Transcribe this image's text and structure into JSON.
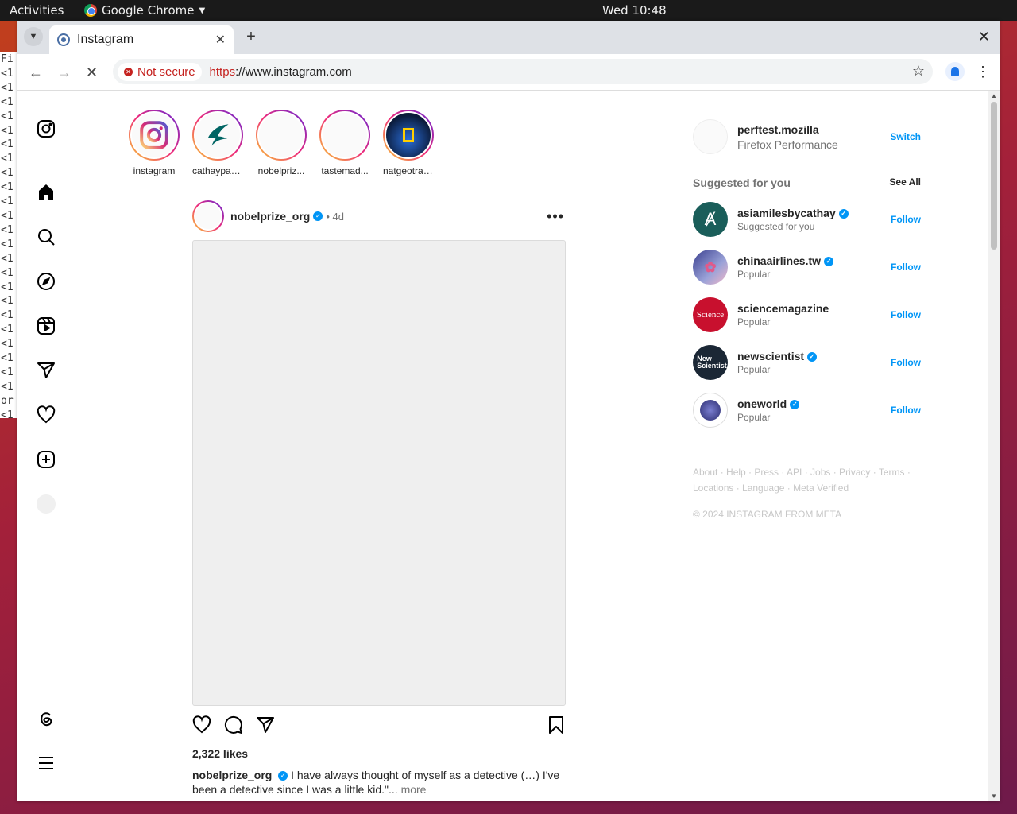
{
  "system": {
    "activities": "Activities",
    "app_name": "Google Chrome",
    "clock": "Wed 10:48"
  },
  "terminal": {
    "lines": [
      "Fi",
      "<1",
      "<1",
      "<1",
      "<1",
      "<1",
      "<1",
      "<1",
      "<1",
      "<1",
      "<1",
      "<1",
      "<1",
      "<1",
      "<1",
      "<1",
      "<1",
      "<1",
      "<1",
      "<1",
      "<1",
      "<1",
      "<1",
      "<1",
      "or",
      "<1"
    ]
  },
  "browser": {
    "tab_title": "Instagram",
    "new_tab": "+",
    "security_label": "Not secure",
    "url_scheme": "https",
    "url_rest": "://www.instagram.com"
  },
  "sidebar": {
    "icons": [
      "instagram-logo-icon",
      "home-icon",
      "search-icon",
      "explore-icon",
      "reels-icon",
      "messages-icon",
      "notifications-icon",
      "create-icon",
      "profile-avatar",
      "threads-icon",
      "menu-icon"
    ]
  },
  "stories": [
    {
      "name": "instagram"
    },
    {
      "name": "cathaypac..."
    },
    {
      "name": "nobelpriz..."
    },
    {
      "name": "tastemad..."
    },
    {
      "name": "natgeotravel"
    }
  ],
  "post": {
    "username": "nobelprize_org",
    "time": "4d",
    "likes": "2,322 likes",
    "caption_user": "nobelprize_org",
    "caption_text": "I have always thought of myself as a detective (…) I've been a detective since I was a little kid.\"...",
    "caption_more": "more"
  },
  "account": {
    "username": "perftest.mozilla",
    "fullname": "Firefox Performance",
    "switch": "Switch"
  },
  "suggested": {
    "title": "Suggested for you",
    "see_all": "See All",
    "items": [
      {
        "username": "asiamilesbycathay",
        "sub": "Suggested for you",
        "action": "Follow",
        "color": "#1a5e5a"
      },
      {
        "username": "chinaairlines.tw",
        "sub": "Popular",
        "action": "Follow",
        "color": "#3a3f8f"
      },
      {
        "username": "sciencemagazine",
        "sub": "Popular",
        "action": "Follow",
        "color": "#c8102e"
      },
      {
        "username": "newscientist",
        "sub": "Popular",
        "action": "Follow",
        "color": "#1b2735"
      },
      {
        "username": "oneworld",
        "sub": "Popular",
        "action": "Follow",
        "color": "#2b2c6f"
      }
    ]
  },
  "footer": {
    "links_line1": "About · Help · Press · API · Jobs · Privacy · Terms ·",
    "links_line2": "Locations · Language · Meta Verified",
    "copyright": "© 2024 INSTAGRAM FROM META"
  }
}
